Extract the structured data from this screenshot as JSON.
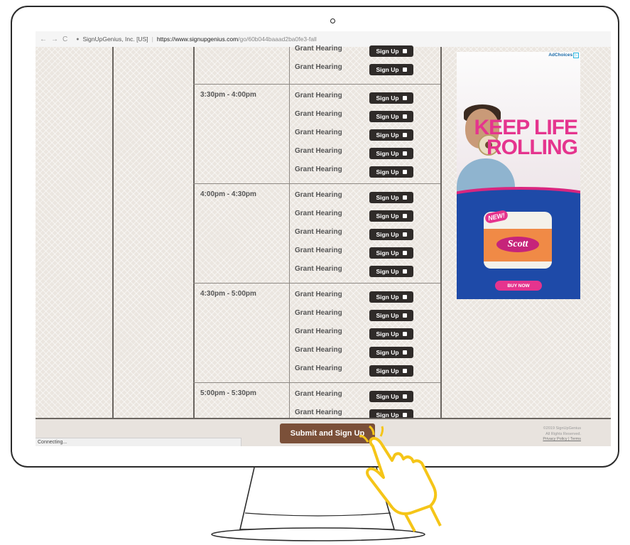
{
  "browser": {
    "site_name": "SignUpGenius, Inc. [US]",
    "url_host": "https://www.signupgenius.com",
    "url_path": "/go/60b044baaad2ba0fe3-fall"
  },
  "slot_label": "Grant Hearing",
  "signup_label": "Sign Up",
  "time_slots": [
    {
      "time": ""
    },
    {
      "time": "3:30pm - 4:00pm"
    },
    {
      "time": "4:00pm - 4:30pm"
    },
    {
      "time": "4:30pm - 5:00pm"
    },
    {
      "time": "5:00pm - 5:30pm"
    }
  ],
  "ad": {
    "adchoices": "AdChoices",
    "headline_1": "KEEP LIFE",
    "headline_2": "ROLLING",
    "badge": "NEW!",
    "brand": "Scott",
    "cta": "BUY NOW"
  },
  "footer": {
    "submit_label": "Submit and Sign Up",
    "copyright": "©2019 SignUpGenius",
    "rights": "All Rights Reserved.",
    "privacy": "Privacy Policy",
    "terms": "Terms"
  },
  "status_text": "Connecting...",
  "colors": {
    "accent_brown": "#7b5039",
    "signup_button": "#2f2b29",
    "ad_pink": "#e5348e",
    "ad_blue": "#1e4aa8",
    "hand_yellow": "#f5c518"
  }
}
